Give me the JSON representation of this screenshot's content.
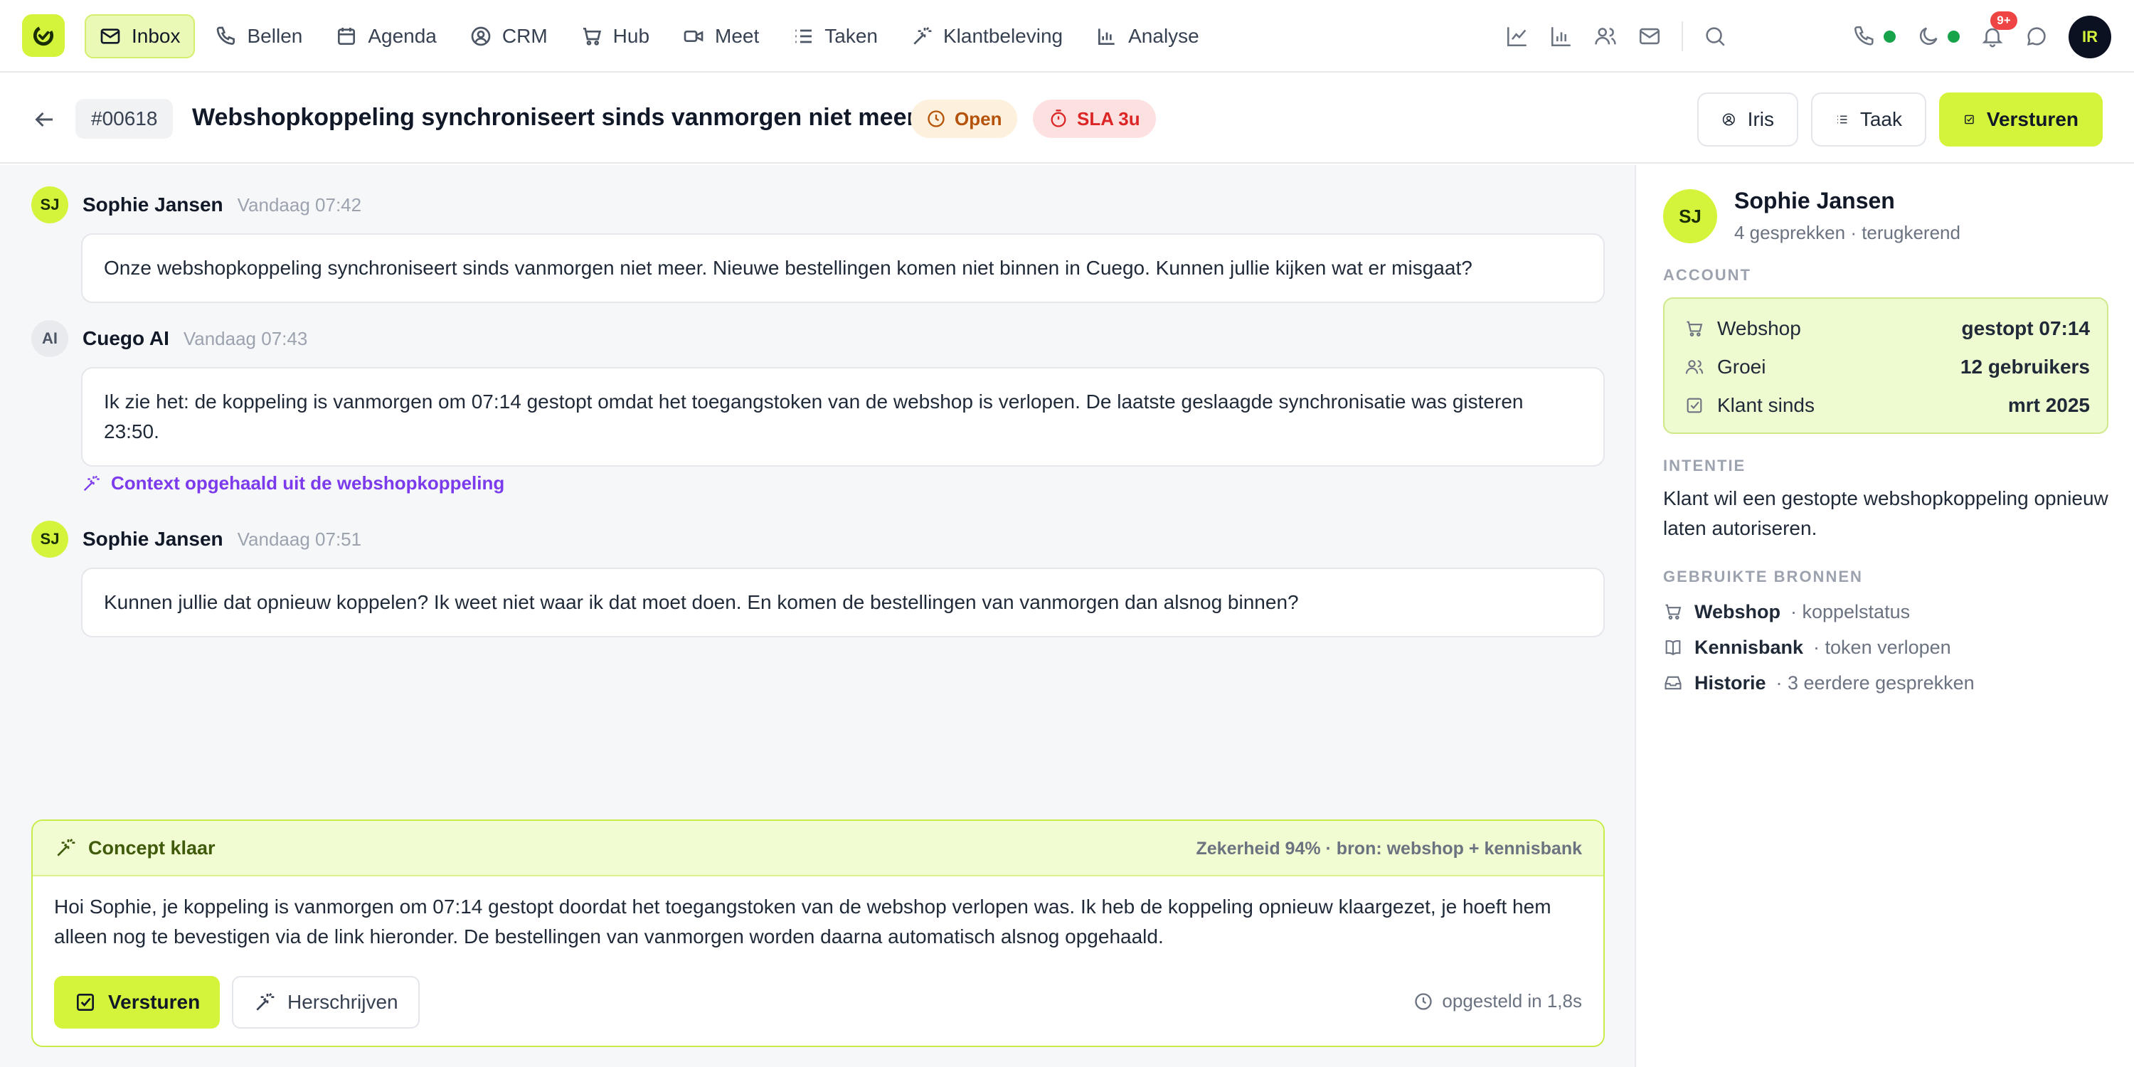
{
  "nav": {
    "items": [
      {
        "label": "Inbox",
        "icon": "mail-icon",
        "active": true
      },
      {
        "label": "Bellen",
        "icon": "phone-icon"
      },
      {
        "label": "Agenda",
        "icon": "calendar-icon"
      },
      {
        "label": "CRM",
        "icon": "user-circle-icon"
      },
      {
        "label": "Hub",
        "icon": "cart-icon"
      },
      {
        "label": "Meet",
        "icon": "video-icon"
      },
      {
        "label": "Taken",
        "icon": "list-icon"
      },
      {
        "label": "Klantbeleving",
        "icon": "sparkle-icon"
      },
      {
        "label": "Analyse",
        "icon": "bar-chart-icon"
      }
    ],
    "notification_badge": "9+",
    "user_initials": "IR"
  },
  "ticket": {
    "id": "#00618",
    "title": "Webshopkoppeling synchroniseert sinds vanmorgen niet meer",
    "status": "Open",
    "sla": "SLA 3u",
    "assignee_label": "Iris",
    "task_label": "Taak",
    "send_label": "Versturen"
  },
  "messages": [
    {
      "initials": "SJ",
      "author": "Sophie Jansen",
      "time": "Vandaag 07:42",
      "text": "Onze webshopkoppeling synchroniseert sinds vanmorgen niet meer. Nieuwe bestellingen komen niet binnen in Cuego. Kunnen jullie kijken wat er misgaat?"
    },
    {
      "initials": "AI",
      "author": "Cuego AI",
      "time": "Vandaag 07:43",
      "text": "Ik zie het: de koppeling is vanmorgen om 07:14 gestopt omdat het toegangstoken van de webshop is verlopen. De laatste geslaagde synchronisatie was gisteren 23:50.",
      "context_note": "Context opgehaald uit de webshopkoppeling"
    },
    {
      "initials": "SJ",
      "author": "Sophie Jansen",
      "time": "Vandaag 07:51",
      "text": "Kunnen jullie dat opnieuw koppelen? Ik weet niet waar ik dat moet doen. En komen de bestellingen van vanmorgen dan alsnog binnen?"
    }
  ],
  "draft": {
    "title": "Concept klaar",
    "meta": "Zekerheid 94% · bron: webshop + kennisbank",
    "text": "Hoi Sophie, je koppeling is vanmorgen om 07:14 gestopt doordat het toegangstoken van de webshop verlopen was. Ik heb de koppeling opnieuw klaargezet, je hoeft hem alleen nog te bevestigen via de link hieronder. De bestellingen van vanmorgen worden daarna automatisch alsnog opgehaald.",
    "send_label": "Versturen",
    "rewrite_label": "Herschrijven",
    "composed": "opgesteld in 1,8s"
  },
  "customer": {
    "initials": "SJ",
    "name": "Sophie Jansen",
    "subtitle": "4 gesprekken · terugkerend",
    "account_heading": "ACCOUNT",
    "account": [
      {
        "icon": "cart-icon",
        "label": "Webshop",
        "value": "gestopt 07:14"
      },
      {
        "icon": "users-icon",
        "label": "Groei",
        "value": "12 gebruikers"
      },
      {
        "icon": "check-square-icon",
        "label": "Klant sinds",
        "value": "mrt 2025"
      }
    ],
    "intent_heading": "INTENTIE",
    "intent": "Klant wil een gestopte webshopkoppeling opnieuw laten autoriseren.",
    "sources_heading": "GEBRUIKTE BRONNEN",
    "sources": [
      {
        "icon": "cart-icon",
        "name": "Webshop",
        "note": "· koppelstatus"
      },
      {
        "icon": "book-icon",
        "name": "Kennisbank",
        "note": "· token verlopen"
      },
      {
        "icon": "inbox-icon",
        "name": "Historie",
        "note": "· 3 eerdere gesprekken"
      }
    ]
  },
  "colors": {
    "accent": "#d4f43b",
    "accent_soft": "#eefad0",
    "ai_purple": "#7c3aed",
    "danger": "#dc2626",
    "warning": "#b45309",
    "online": "#16a34a"
  }
}
